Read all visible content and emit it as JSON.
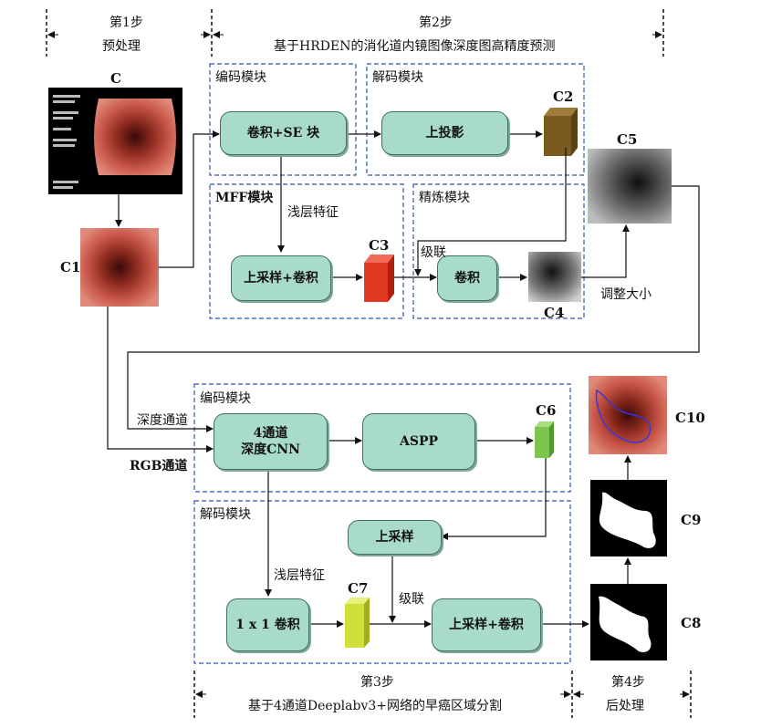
{
  "steps": {
    "step1": {
      "title": "第1步",
      "subtitle": "预处理"
    },
    "step2": {
      "title": "第2步",
      "subtitle": "基于HRDEN的消化道内镜图像深度图高精度预测"
    },
    "step3": {
      "title": "第3步",
      "subtitle": "基于4通道Deeplabv3+网络的早癌区域分割"
    },
    "step4": {
      "title": "第4步",
      "subtitle": "后处理"
    }
  },
  "modules": {
    "encoder_top": "编码模块",
    "decoder_top": "解码模块",
    "mff": "MFF模块",
    "refine": "精炼模块",
    "encoder_bottom": "编码模块",
    "decoder_bottom": "解码模块"
  },
  "blocks": {
    "conv_se": "卷积+SE 块",
    "upproj": "上投影",
    "upsample_conv_top": "上采样+卷积",
    "conv": "卷积",
    "cnn4_line1": "4通道",
    "cnn4_line2": "深度CNN",
    "aspp": "ASPP",
    "upsample": "上采样",
    "conv1x1": "1 x 1 卷积",
    "upsample_conv_bottom": "上采样+卷积"
  },
  "edge_labels": {
    "shallow_top": "浅层特征",
    "concat_top": "级联",
    "resize": "调整大小",
    "depth_channel": "深度通道",
    "rgb_channel": "RGB通道",
    "shallow_bottom": "浅层特征",
    "concat_bottom": "级联"
  },
  "images": {
    "C": "C",
    "C1": "C1",
    "C2": "C2",
    "C3": "C3",
    "C4": "C4",
    "C5": "C5",
    "C6": "C6",
    "C7": "C7",
    "C8": "C8",
    "C9": "C9",
    "C10": "C10"
  },
  "colors": {
    "block_fill": "#a8dcc8",
    "dashed_border": "#2b55b0",
    "c2_cube": "#7a5a1e",
    "c3_cube": "#e23a22",
    "c6_cube": "#7bc74d",
    "c7_cube": "#cfe03a"
  }
}
